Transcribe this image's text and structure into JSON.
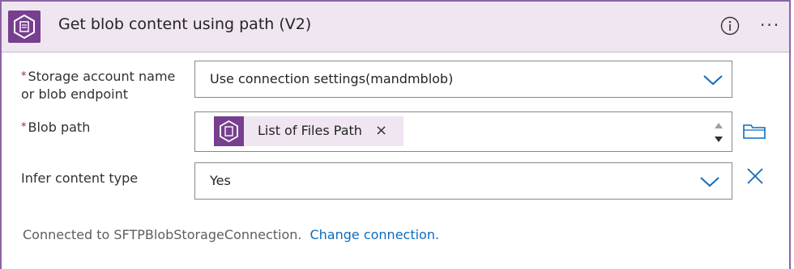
{
  "header": {
    "title": "Get blob content using path (V2)",
    "icon": "blob-storage-icon",
    "info_icon": "info-icon",
    "more_icon": "more-options-icon",
    "more_label": "···"
  },
  "fields": {
    "storage_account": {
      "required_mark": "*",
      "label_line1": "Storage account name",
      "label_line2": "or blob endpoint",
      "value": "Use connection settings(mandmblob)"
    },
    "blob_path": {
      "required_mark": "*",
      "label": "Blob path",
      "token_label": "List of Files Path",
      "token_remove": "×"
    },
    "infer_content_type": {
      "label": "Infer content type",
      "value": "Yes"
    }
  },
  "footer": {
    "connected_text": "Connected to SFTPBlobStorageConnection.",
    "change_link": "Change connection."
  },
  "colors": {
    "accent": "#773f8f",
    "header_bg": "#efe6f1",
    "border": "#8a64a4",
    "link": "#0f6cbd",
    "required": "#a4262c"
  }
}
